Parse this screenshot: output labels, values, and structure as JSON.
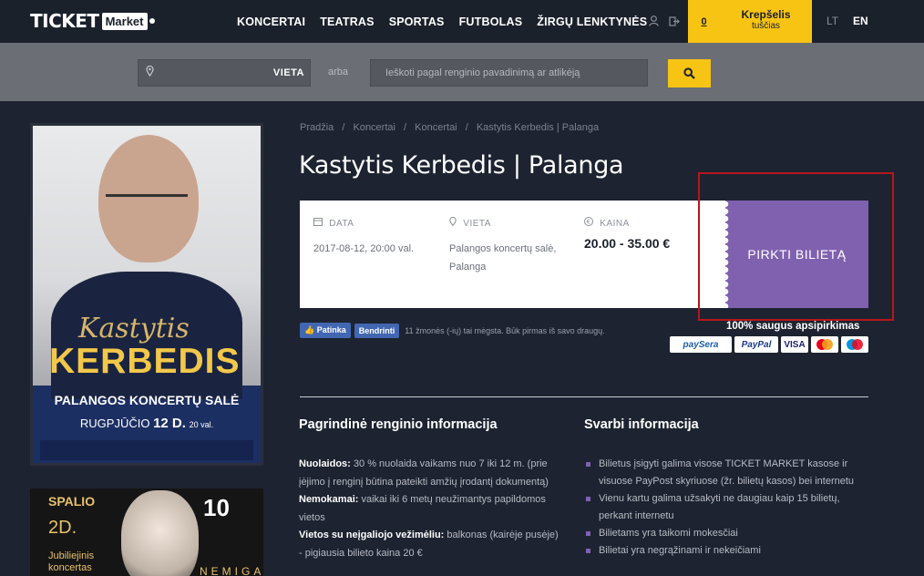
{
  "header": {
    "logo_left": "TICKET",
    "logo_right": "Market",
    "nav": [
      "KONCERTAI",
      "TEATRAS",
      "SPORTAS",
      "FUTBOLAS",
      "ŽIRGŲ LENKTYNĖS"
    ],
    "cart_count": "0",
    "cart_label": "Krepšelis",
    "cart_status": "tuščias",
    "lang_lt": "LT",
    "lang_en": "EN"
  },
  "search": {
    "location_label": "VIETA",
    "or": "arba",
    "placeholder": "Ieškoti pagal renginio pavadinimą ar atlikėją"
  },
  "breadcrumb": [
    "Pradžia",
    "/",
    "Koncertai",
    "/",
    "Koncertai",
    "/",
    "Kastytis Kerbedis | Palanga"
  ],
  "event": {
    "title": "Kastytis Kerbedis | Palanga",
    "date_label": "DATA",
    "date_value": "2017-08-12, 20:00 val.",
    "venue_label": "VIETA",
    "venue_line1": "Palangos koncertų salė,",
    "venue_line2": "Palanga",
    "price_label": "KAINA",
    "price_value": "20.00 - 35.00 €",
    "buy_label": "PIRKTI BILIETĄ"
  },
  "social": {
    "like": "Patinka",
    "share": "Bendrinti",
    "text": "11 žmonės (-ių) tai mėgsta. Būk pirmas iš savo draugų."
  },
  "payments": {
    "secure": "100% saugus apsipirkimas",
    "methods": [
      "paySera",
      "PayPal",
      "VISA",
      "MC",
      "Maestro"
    ]
  },
  "poster1": {
    "script": "Kastytis",
    "name": "KERBEDIS",
    "venue": "PALANGOS KONCERTŲ SALĖ",
    "date_month": "RUGPJŪČIO",
    "date_day": "12 D.",
    "date_time": "20 val."
  },
  "poster2": {
    "month": "SPALIO",
    "day": "2D.",
    "line1": "Jubiliejinis",
    "line2": "koncertas",
    "number": "10",
    "venue": "NEMIGA"
  },
  "info": {
    "main_heading": "Pagrindinė renginio informacija",
    "discount_label": "Nuolaidos:",
    "discount_text": " 30 % nuolaida vaikams nuo 7 iki 12 m. (prie įėjimo į renginį būtina pateikti amžių įrodantį dokumentą)",
    "free_label": "Nemokamai:",
    "free_text": " vaikai iki 6 metų neužimantys papildomos vietos",
    "wheelchair_label": "Vietos su neįgaliojo vežimėliu:",
    "wheelchair_text": " balkonas (kairėje pusėje) - pigiausia bilieto kaina 20 €",
    "important_heading": "Svarbi informacija",
    "important_items": [
      "Bilietus įsigyti galima visose TICKET MARKET kasose ir visuose PayPost skyriuose (žr. bilietų kasos) bei internetu",
      "Vienu kartu galima užsakyti ne daugiau kaip 15 bilietų, perkant internetu",
      "Bilietams yra taikomi mokesčiai",
      "Bilietai yra negrąžinami ir nekeičiami"
    ]
  }
}
